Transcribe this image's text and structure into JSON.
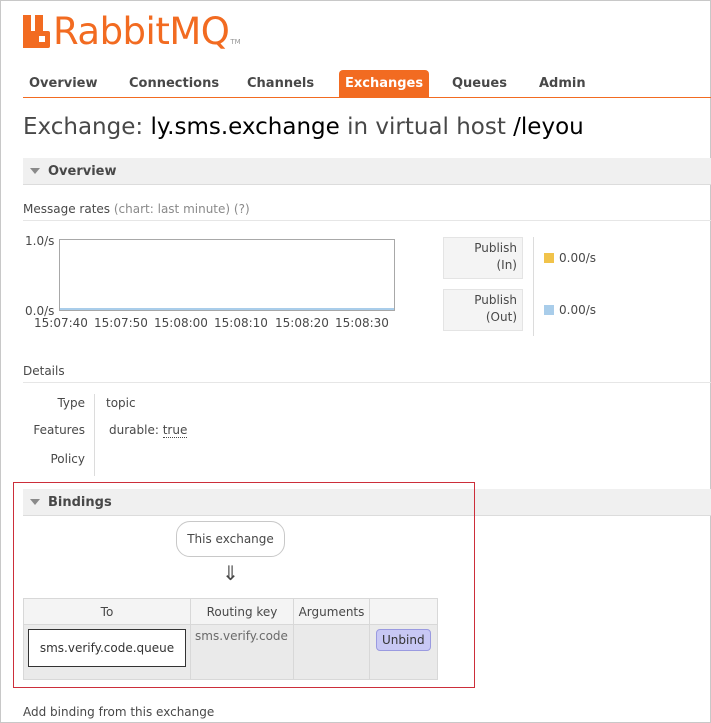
{
  "brand": {
    "name": "RabbitMQ",
    "tm": "TM",
    "color": "#f26b21"
  },
  "nav": {
    "items": [
      {
        "label": "Overview",
        "active": false
      },
      {
        "label": "Connections",
        "active": false
      },
      {
        "label": "Channels",
        "active": false
      },
      {
        "label": "Exchanges",
        "active": true
      },
      {
        "label": "Queues",
        "active": false
      },
      {
        "label": "Admin",
        "active": false
      }
    ]
  },
  "title": {
    "prefix": "Exchange:",
    "exchange": "ly.sms.exchange",
    "middle": "in virtual host",
    "vhost": "/leyou"
  },
  "overview_section": {
    "label": "Overview"
  },
  "message_rates": {
    "label": "Message rates",
    "chart_hint": "(chart: last minute) (?)",
    "y_top": "1.0/s",
    "y_bottom": "0.0/s",
    "x_ticks": [
      "15:07:40",
      "15:07:50",
      "15:08:00",
      "15:08:10",
      "15:08:20",
      "15:08:30"
    ],
    "publish_in": {
      "label_1": "Publish",
      "label_2": "(In)",
      "value": "0.00/s",
      "color": "#f1c34a"
    },
    "publish_out": {
      "label_1": "Publish",
      "label_2": "(Out)",
      "value": "0.00/s",
      "color": "#a9cdea"
    }
  },
  "details": {
    "label": "Details",
    "type_key": "Type",
    "type_val": "topic",
    "features_key": "Features",
    "features_name": "durable:",
    "features_val": "true",
    "policy_key": "Policy"
  },
  "bindings": {
    "label": "Bindings",
    "this_exchange": "This exchange",
    "arrow": "⇓",
    "columns": [
      "To",
      "Routing key",
      "Arguments",
      ""
    ],
    "row": {
      "to": "sms.verify.code.queue",
      "routing_key": "sms.verify.code",
      "arguments": "",
      "action": "Unbind"
    }
  },
  "add_binding": {
    "label": "Add binding from this exchange"
  }
}
